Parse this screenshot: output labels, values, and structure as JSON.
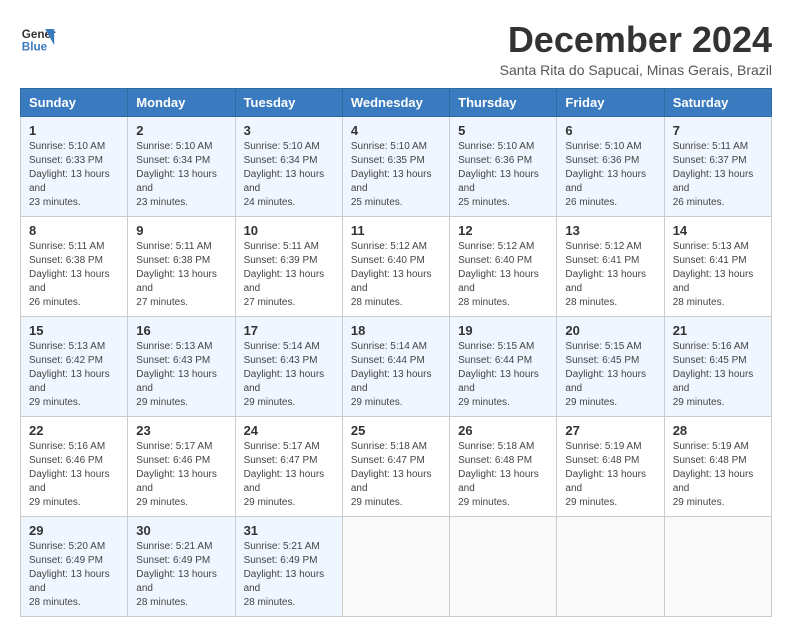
{
  "logo": {
    "line1": "General",
    "line2": "Blue"
  },
  "title": "December 2024",
  "subtitle": "Santa Rita do Sapucai, Minas Gerais, Brazil",
  "weekdays": [
    "Sunday",
    "Monday",
    "Tuesday",
    "Wednesday",
    "Thursday",
    "Friday",
    "Saturday"
  ],
  "weeks": [
    [
      {
        "day": "1",
        "sunrise": "5:10 AM",
        "sunset": "6:33 PM",
        "daylight": "13 hours and 23 minutes."
      },
      {
        "day": "2",
        "sunrise": "5:10 AM",
        "sunset": "6:34 PM",
        "daylight": "13 hours and 23 minutes."
      },
      {
        "day": "3",
        "sunrise": "5:10 AM",
        "sunset": "6:34 PM",
        "daylight": "13 hours and 24 minutes."
      },
      {
        "day": "4",
        "sunrise": "5:10 AM",
        "sunset": "6:35 PM",
        "daylight": "13 hours and 25 minutes."
      },
      {
        "day": "5",
        "sunrise": "5:10 AM",
        "sunset": "6:36 PM",
        "daylight": "13 hours and 25 minutes."
      },
      {
        "day": "6",
        "sunrise": "5:10 AM",
        "sunset": "6:36 PM",
        "daylight": "13 hours and 26 minutes."
      },
      {
        "day": "7",
        "sunrise": "5:11 AM",
        "sunset": "6:37 PM",
        "daylight": "13 hours and 26 minutes."
      }
    ],
    [
      {
        "day": "8",
        "sunrise": "5:11 AM",
        "sunset": "6:38 PM",
        "daylight": "13 hours and 26 minutes."
      },
      {
        "day": "9",
        "sunrise": "5:11 AM",
        "sunset": "6:38 PM",
        "daylight": "13 hours and 27 minutes."
      },
      {
        "day": "10",
        "sunrise": "5:11 AM",
        "sunset": "6:39 PM",
        "daylight": "13 hours and 27 minutes."
      },
      {
        "day": "11",
        "sunrise": "5:12 AM",
        "sunset": "6:40 PM",
        "daylight": "13 hours and 28 minutes."
      },
      {
        "day": "12",
        "sunrise": "5:12 AM",
        "sunset": "6:40 PM",
        "daylight": "13 hours and 28 minutes."
      },
      {
        "day": "13",
        "sunrise": "5:12 AM",
        "sunset": "6:41 PM",
        "daylight": "13 hours and 28 minutes."
      },
      {
        "day": "14",
        "sunrise": "5:13 AM",
        "sunset": "6:41 PM",
        "daylight": "13 hours and 28 minutes."
      }
    ],
    [
      {
        "day": "15",
        "sunrise": "5:13 AM",
        "sunset": "6:42 PM",
        "daylight": "13 hours and 29 minutes."
      },
      {
        "day": "16",
        "sunrise": "5:13 AM",
        "sunset": "6:43 PM",
        "daylight": "13 hours and 29 minutes."
      },
      {
        "day": "17",
        "sunrise": "5:14 AM",
        "sunset": "6:43 PM",
        "daylight": "13 hours and 29 minutes."
      },
      {
        "day": "18",
        "sunrise": "5:14 AM",
        "sunset": "6:44 PM",
        "daylight": "13 hours and 29 minutes."
      },
      {
        "day": "19",
        "sunrise": "5:15 AM",
        "sunset": "6:44 PM",
        "daylight": "13 hours and 29 minutes."
      },
      {
        "day": "20",
        "sunrise": "5:15 AM",
        "sunset": "6:45 PM",
        "daylight": "13 hours and 29 minutes."
      },
      {
        "day": "21",
        "sunrise": "5:16 AM",
        "sunset": "6:45 PM",
        "daylight": "13 hours and 29 minutes."
      }
    ],
    [
      {
        "day": "22",
        "sunrise": "5:16 AM",
        "sunset": "6:46 PM",
        "daylight": "13 hours and 29 minutes."
      },
      {
        "day": "23",
        "sunrise": "5:17 AM",
        "sunset": "6:46 PM",
        "daylight": "13 hours and 29 minutes."
      },
      {
        "day": "24",
        "sunrise": "5:17 AM",
        "sunset": "6:47 PM",
        "daylight": "13 hours and 29 minutes."
      },
      {
        "day": "25",
        "sunrise": "5:18 AM",
        "sunset": "6:47 PM",
        "daylight": "13 hours and 29 minutes."
      },
      {
        "day": "26",
        "sunrise": "5:18 AM",
        "sunset": "6:48 PM",
        "daylight": "13 hours and 29 minutes."
      },
      {
        "day": "27",
        "sunrise": "5:19 AM",
        "sunset": "6:48 PM",
        "daylight": "13 hours and 29 minutes."
      },
      {
        "day": "28",
        "sunrise": "5:19 AM",
        "sunset": "6:48 PM",
        "daylight": "13 hours and 29 minutes."
      }
    ],
    [
      {
        "day": "29",
        "sunrise": "5:20 AM",
        "sunset": "6:49 PM",
        "daylight": "13 hours and 28 minutes."
      },
      {
        "day": "30",
        "sunrise": "5:21 AM",
        "sunset": "6:49 PM",
        "daylight": "13 hours and 28 minutes."
      },
      {
        "day": "31",
        "sunrise": "5:21 AM",
        "sunset": "6:49 PM",
        "daylight": "13 hours and 28 minutes."
      },
      null,
      null,
      null,
      null
    ]
  ]
}
